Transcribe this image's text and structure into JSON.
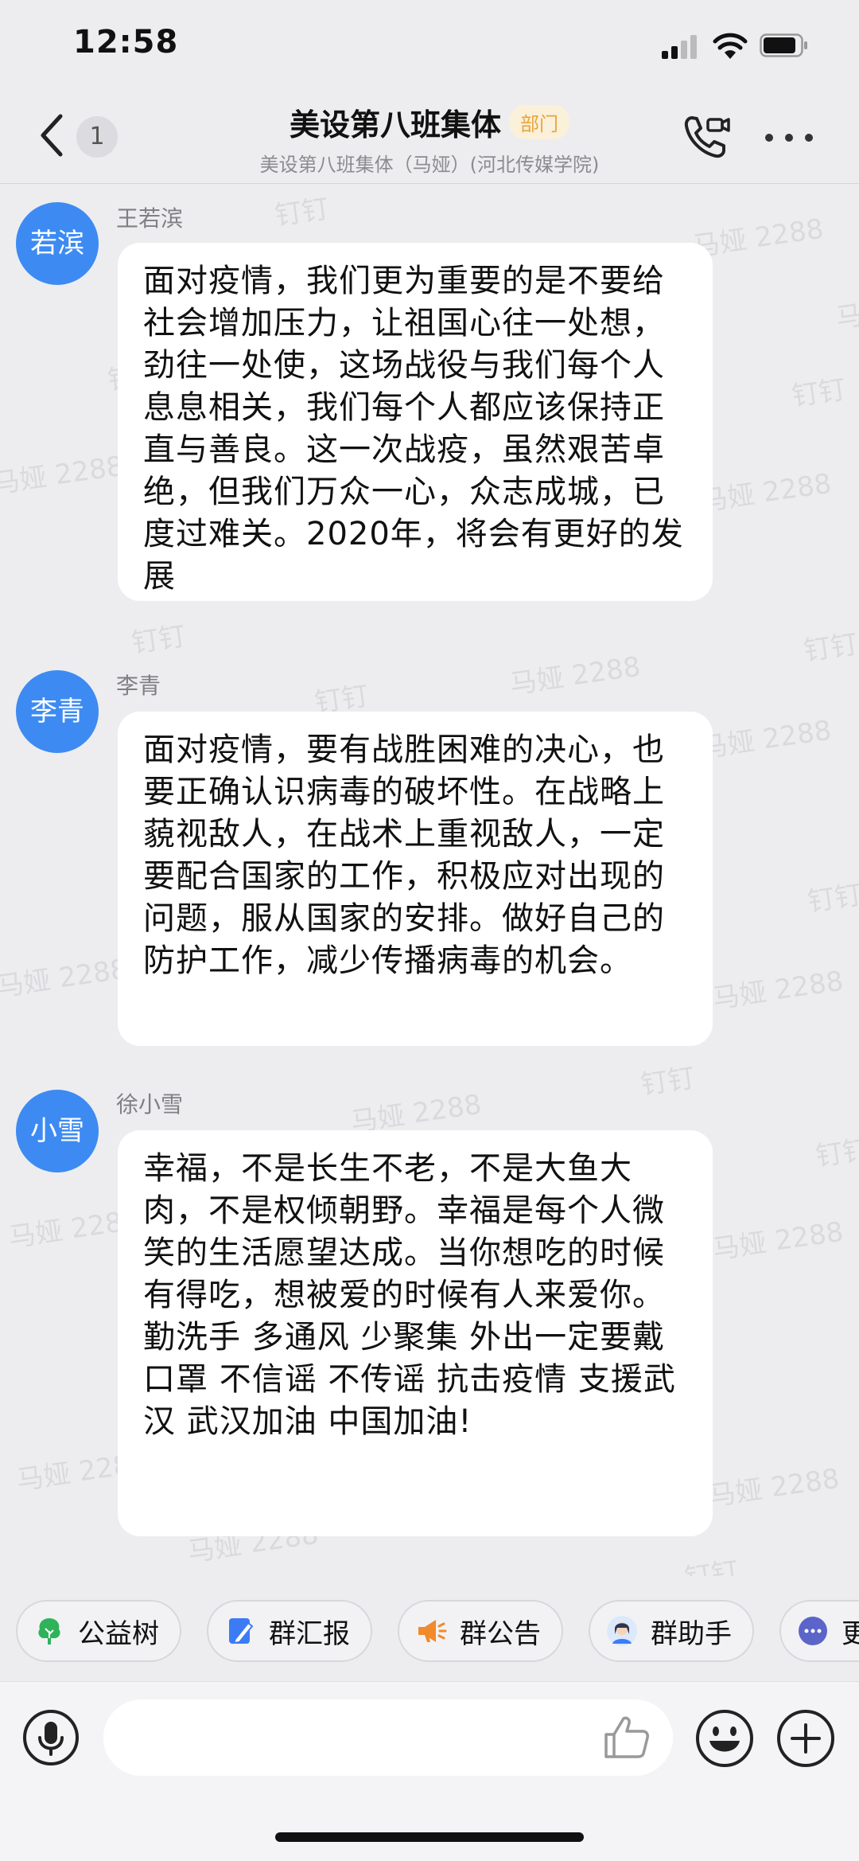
{
  "status_bar": {
    "time": "12:58"
  },
  "header": {
    "back_count": "1",
    "title": "美设第八班集体",
    "tag": "部门",
    "subtitle": "美设第八班集体（马娅）(河北传媒学院)"
  },
  "watermarks": [
    "钉钉",
    "马娅 2288"
  ],
  "messages": [
    {
      "avatar_text": "若滨",
      "sender": "王若滨",
      "text": "面对疫情，我们更为重要的是不要给社会增加压力，让祖国心往一处想，劲往一处使，这场战役与我们每个人息息相关，我们每个人都应该保持正直与善良。这一次战疫，虽然艰苦卓绝，但我们万众一心，众志成城，已度过难关。2020年，将会有更好的发展"
    },
    {
      "avatar_text": "李青",
      "sender": "李青",
      "text": "面对疫情，要有战胜困难的决心，也要正确认识病毒的破坏性。在战略上藐视敌人，在战术上重视敌人，一定要配合国家的工作，积极应对出现的问题，服从国家的安排。做好自己的防护工作，减少传播病毒的机会。"
    },
    {
      "avatar_text": "小雪",
      "sender": "徐小雪",
      "text": " 幸福，不是长生不老，不是大鱼大肉，不是权倾朝野。幸福是每个人微笑的生活愿望达成。当你想吃的时候有得吃，想被爱的时候有人来爱你。 勤洗手 多通风 少聚集 外出一定要戴口罩 不信谣 不传谣 抗击疫情 支援武汉 武汉加油 中国加油!"
    }
  ],
  "quick_actions": [
    {
      "label": "公益树",
      "icon": "tree-icon"
    },
    {
      "label": "群汇报",
      "icon": "report-icon"
    },
    {
      "label": "群公告",
      "icon": "megaphone-icon"
    },
    {
      "label": "群助手",
      "icon": "assistant-icon"
    },
    {
      "label": "更",
      "icon": "more-dots-icon"
    }
  ],
  "input": {
    "placeholder": ""
  },
  "colors": {
    "avatar": "#3d8bf2",
    "background": "#ededf0",
    "tag_text": "#e8a63a",
    "tree_green": "#2fb35a",
    "report_blue": "#3b7cf5",
    "megaphone_orange": "#f08a2b"
  }
}
